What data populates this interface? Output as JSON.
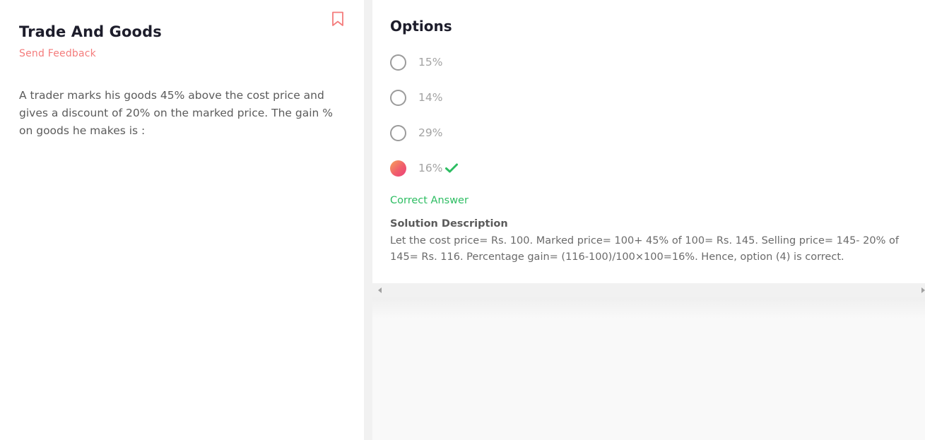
{
  "question": {
    "title": "Trade And Goods",
    "feedback_label": "Send Feedback",
    "text": "A trader marks his goods 45% above the cost price and gives a discount of 20% on the marked price. The gain % on goods he makes is :",
    "bookmark_icon": "bookmark-icon"
  },
  "options": {
    "heading": "Options",
    "items": [
      {
        "label": "15%",
        "selected": false
      },
      {
        "label": "14%",
        "selected": false
      },
      {
        "label": "29%",
        "selected": false
      },
      {
        "label": "16%",
        "selected": true,
        "correct": true
      }
    ],
    "correct_label": "Correct Answer",
    "solution_heading": "Solution Description",
    "solution_text": "Let the cost price= Rs. 100. Marked price= 100+ 45% of 100= Rs. 145. Selling price= 145- 20% of 145= Rs. 116. Percentage gain= (116-100)/100×100=16%. Hence, option (4) is correct."
  },
  "colors": {
    "accent": "#f47c7c",
    "correct": "#2dbd62",
    "title": "#1d1d2b"
  }
}
